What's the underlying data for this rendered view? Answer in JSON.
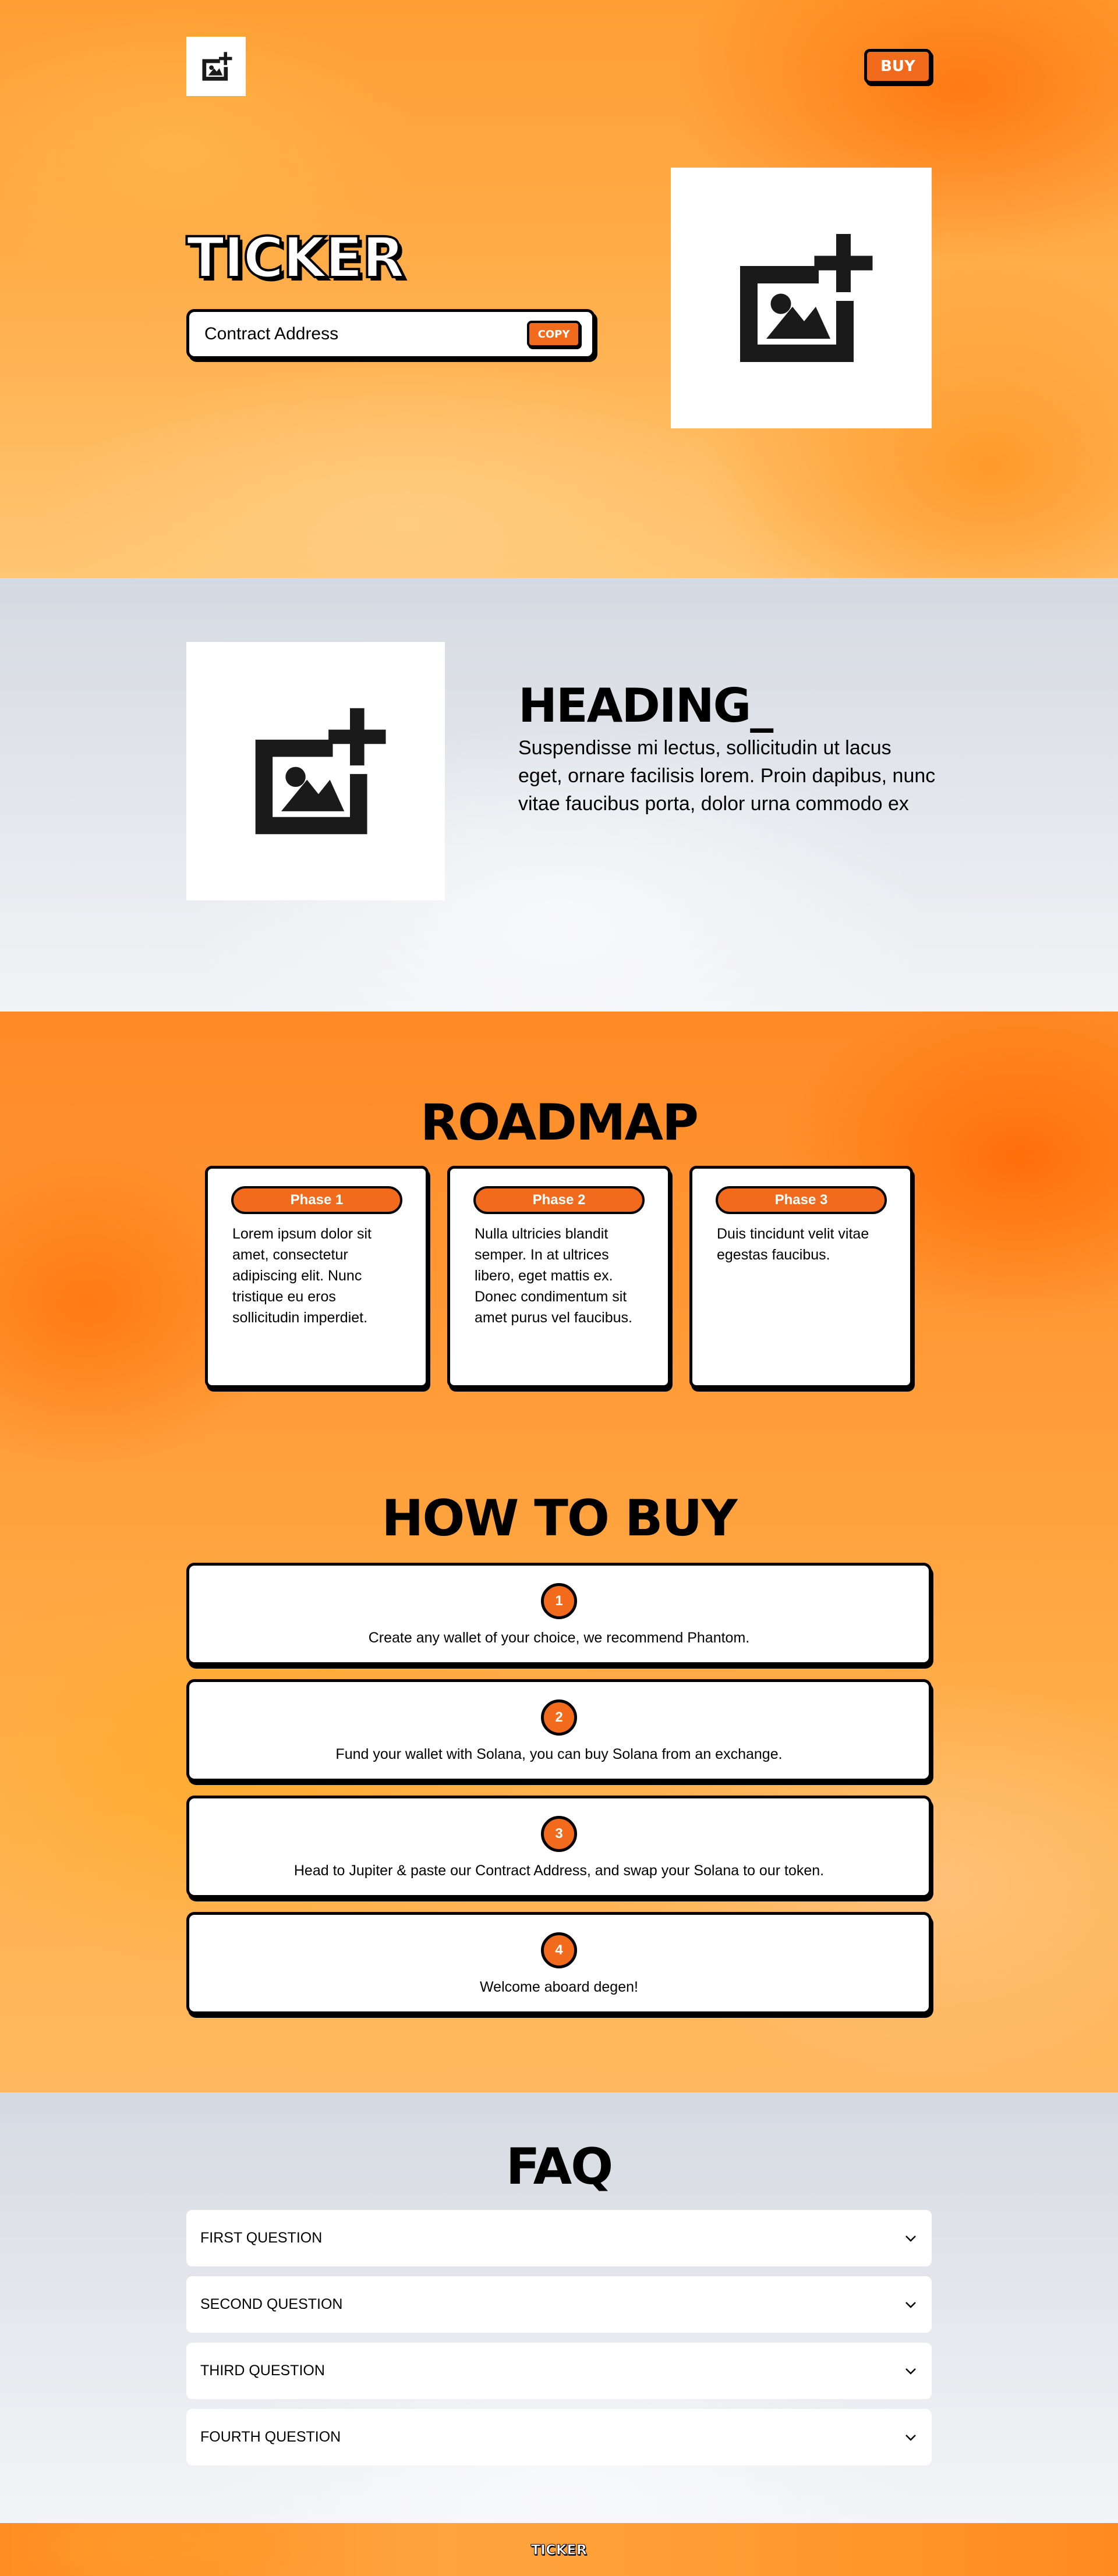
{
  "header": {
    "logo_icon": "image-add-icon",
    "buy_label": "BUY"
  },
  "hero": {
    "ticker": "TICKER",
    "contract_address": "Contract Address",
    "copy_label": "COPY",
    "image_icon": "image-add-icon"
  },
  "about": {
    "image_icon": "image-add-icon",
    "heading": "HEADING_",
    "text": "Suspendisse mi lectus, sollicitudin ut lacus eget, ornare facilisis lorem. Proin dapibus, nunc vitae faucibus porta, dolor urna commodo ex"
  },
  "roadmap": {
    "title": "ROADMAP",
    "phases": [
      {
        "label": "Phase 1",
        "text": "Lorem ipsum dolor sit amet, consectetur adipiscing elit. Nunc tristique eu eros sollicitudin imperdiet."
      },
      {
        "label": "Phase 2",
        "text": "Nulla ultricies blandit semper. In at ultrices libero, eget mattis ex. Donec condimentum sit amet purus vel faucibus."
      },
      {
        "label": "Phase 3",
        "text": "Duis tincidunt velit vitae egestas faucibus."
      }
    ]
  },
  "how_to_buy": {
    "title": "HOW TO BUY",
    "steps": [
      {
        "number": "1",
        "text": "Create any wallet of your choice, we recommend Phantom."
      },
      {
        "number": "2",
        "text": "Fund your wallet with Solana, you can buy Solana from an exchange."
      },
      {
        "number": "3",
        "text": "Head to Jupiter & paste our Contract Address, and swap your Solana to our token."
      },
      {
        "number": "4",
        "text": "Welcome aboard degen!"
      }
    ]
  },
  "faq": {
    "title": "FAQ",
    "items": [
      {
        "question": "FIRST QUESTION"
      },
      {
        "question": "SECOND QUESTION"
      },
      {
        "question": "THIRD QUESTION"
      },
      {
        "question": "FOURTH QUESTION"
      }
    ],
    "expand_icon": "chevron-down-icon"
  },
  "footer": {
    "text": "TICKER"
  },
  "colors": {
    "accent": "#f26b1d",
    "outline": "#000000",
    "card": "#ffffff"
  }
}
